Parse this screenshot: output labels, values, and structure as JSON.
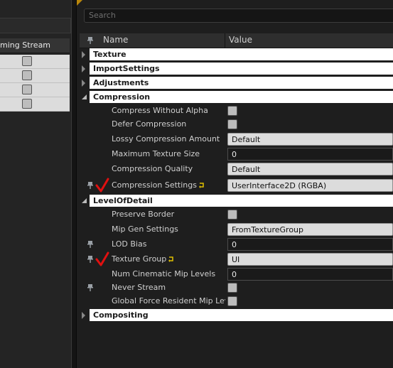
{
  "left_panel": {
    "header_label": "ming Stream",
    "rows": 4
  },
  "search": {
    "placeholder": "Search"
  },
  "header": {
    "name_label": "Name",
    "value_label": "Value"
  },
  "categories": {
    "texture": "Texture",
    "import_settings": "ImportSettings",
    "adjustments": "Adjustments",
    "compression": "Compression",
    "level_of_detail": "LevelOfDetail",
    "compositing": "Compositing"
  },
  "compression": {
    "compress_without_alpha": "Compress Without Alpha",
    "defer_compression": "Defer Compression",
    "lossy_compression_amount": "Lossy Compression Amount",
    "lossy_compression_amount_value": "Default",
    "maximum_texture_size": "Maximum Texture Size",
    "maximum_texture_size_value": "0",
    "compression_quality": "Compression Quality",
    "compression_quality_value": "Default",
    "compression_settings": "Compression Settings",
    "compression_settings_value": "UserInterface2D (RGBA)"
  },
  "level_of_detail": {
    "preserve_border": "Preserve Border",
    "mip_gen_settings": "Mip Gen Settings",
    "mip_gen_settings_value": "FromTextureGroup",
    "lod_bias": "LOD Bias",
    "lod_bias_value": "0",
    "texture_group": "Texture Group",
    "texture_group_value": "UI",
    "num_cinematic_mip_levels": "Num Cinematic Mip Levels",
    "num_cinematic_mip_levels_value": "0",
    "never_stream": "Never Stream",
    "global_force_resident_mip_levels": "Global Force Resident Mip Leve"
  },
  "colors": {
    "check_mark": "#e01010",
    "category_bar": "#ffffff",
    "reset_arrow": "#e0c000"
  },
  "icons": [
    "pin-icon",
    "check-mark-icon",
    "reset-to-default-icon",
    "expand-arrow-icon",
    "collapse-arrow-icon"
  ]
}
